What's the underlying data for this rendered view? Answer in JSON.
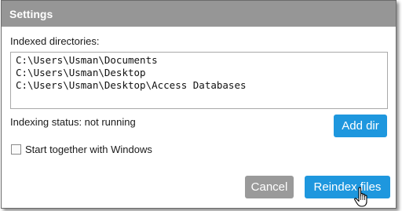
{
  "window": {
    "title": "Settings"
  },
  "directories": {
    "label": "Indexed directories:",
    "items": [
      "C:\\Users\\Usman\\Documents",
      "C:\\Users\\Usman\\Desktop",
      "C:\\Users\\Usman\\Desktop\\Access Databases"
    ]
  },
  "status": {
    "text": "Indexing status: not running"
  },
  "buttons": {
    "add_dir": "Add dir",
    "cancel": "Cancel",
    "reindex": "Reindex files"
  },
  "options": {
    "start_with_windows_label": "Start together with Windows",
    "start_with_windows_checked": false
  },
  "colors": {
    "titlebar": "#969696",
    "primary_button": "#1e97de",
    "secondary_button": "#9a9a9a"
  },
  "icons": {
    "cursor": "hand-pointer-icon"
  }
}
